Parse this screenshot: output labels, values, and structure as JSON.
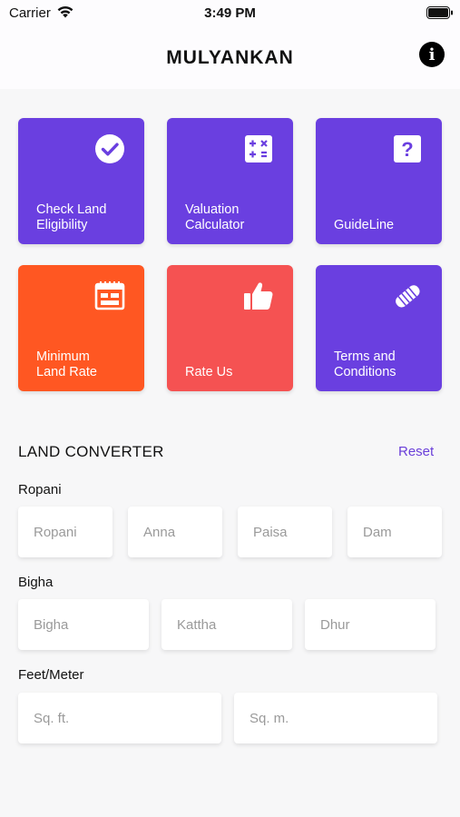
{
  "status_bar": {
    "carrier": "Carrier",
    "time": "3:49 PM"
  },
  "header": {
    "title": "MULYANKAN",
    "info_icon": "info-icon"
  },
  "tiles": [
    {
      "label": "Check Land\nEligibility",
      "icon": "checkmark-circle-icon",
      "color": "#6a3fe0"
    },
    {
      "label": "Valuation\nCalculator",
      "icon": "calculator-icon",
      "color": "#6a3fe0"
    },
    {
      "label": "GuideLine",
      "icon": "help-square-icon",
      "color": "#6a3fe0"
    },
    {
      "label": "Minimum\nLand Rate",
      "icon": "table-calendar-icon",
      "color": "#ff5722"
    },
    {
      "label": "Rate Us",
      "icon": "thumbs-up-icon",
      "color": "#f55252"
    },
    {
      "label": "Terms and\nConditions",
      "icon": "handshake-icon",
      "color": "#6a3fe0"
    }
  ],
  "converter": {
    "title": "LAND CONVERTER",
    "reset_label": "Reset",
    "ropani": {
      "label": "Ropani",
      "fields": [
        "Ropani",
        "Anna",
        "Paisa",
        "Dam"
      ]
    },
    "bigha": {
      "label": "Bigha",
      "fields": [
        "Bigha",
        "Kattha",
        "Dhur"
      ]
    },
    "feet_meter": {
      "label": "Feet/Meter",
      "fields": [
        "Sq. ft.",
        "Sq. m."
      ]
    }
  },
  "colors": {
    "accent": "#6a3fd9"
  }
}
